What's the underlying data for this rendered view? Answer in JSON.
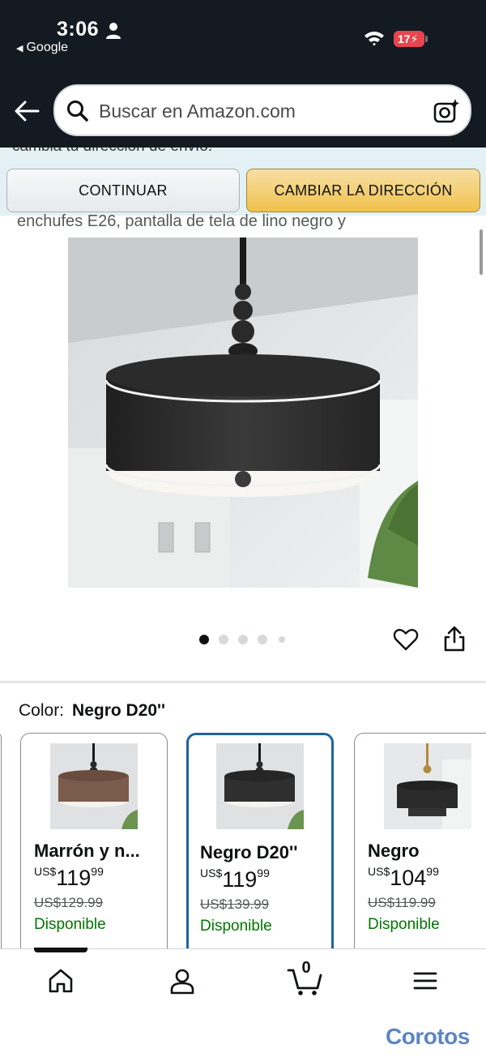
{
  "status_bar": {
    "time": "3:06",
    "back_app": "Google",
    "battery": "17"
  },
  "search": {
    "placeholder": "Buscar en Amazon.com"
  },
  "location_banner": {
    "text": "cambia tu dirección de envío.",
    "continue_label": "CONTINUAR",
    "change_label": "CAMBIAR LA DIRECCIÓN"
  },
  "product": {
    "title_fragment": "enchufes E26, pantalla de tela de lino negro y",
    "image_count": 5,
    "active_image": 1
  },
  "color_selector": {
    "label": "Color:",
    "selected": "Negro D20''"
  },
  "variations": [
    {
      "name": "Marrón y n...",
      "currency": "US$",
      "price_whole": "119",
      "price_fraction": "99",
      "was_price": "US$129.99",
      "availability": "Disponible",
      "selected": false
    },
    {
      "name": "Negro D20''",
      "currency": "US$",
      "price_whole": "119",
      "price_fraction": "99",
      "was_price": "US$139.99",
      "availability": "Disponible",
      "selected": true
    },
    {
      "name": "Negro",
      "currency": "US$",
      "price_whole": "104",
      "price_fraction": "99",
      "was_price": "US$119.99",
      "availability": "Disponible",
      "selected": false
    }
  ],
  "bottom_nav": {
    "cart_count": "0",
    "items": [
      "home-icon",
      "account-icon",
      "cart-icon",
      "menu-icon"
    ]
  },
  "watermark": "Corotos",
  "colors": {
    "header_bg": "#131a22",
    "banner_bg": "#e3f1f4",
    "primary_button": "#f0c14b",
    "selected_border": "#2162a1",
    "available_text": "#007600"
  }
}
